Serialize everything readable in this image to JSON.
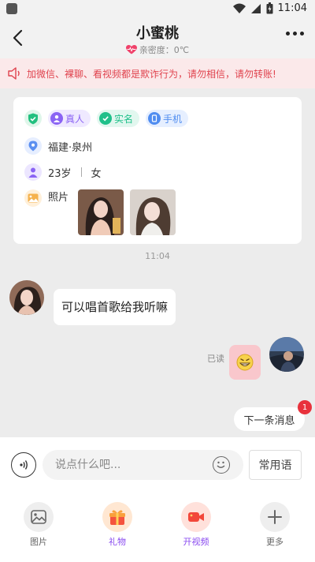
{
  "status_bar": {
    "time": "11:04"
  },
  "header": {
    "title": "小蜜桃",
    "intimacy": "亲密度：0℃"
  },
  "warning": {
    "text": "加微信、裸聊、看视频都是欺诈行为，请勿相信，请勿转账!"
  },
  "profile": {
    "tags": [
      {
        "label": "真人",
        "color": "#8a63f4",
        "bg": "#efe9ff"
      },
      {
        "label": "实名",
        "color": "#20c08a",
        "bg": "#e2f7ef"
      },
      {
        "label": "手机",
        "color": "#4f8cf0",
        "bg": "#e6efff"
      }
    ],
    "location": "福建·泉州",
    "age": "23岁",
    "gender": "女",
    "photos_label": "照片"
  },
  "chat": {
    "timestamp": "11:04",
    "incoming_message": "可以唱首歌给我听嘛",
    "read_status": "已读",
    "next_message_label": "下一条消息",
    "next_message_count": "1"
  },
  "input_bar": {
    "placeholder": "说点什么吧...",
    "phrases_label": "常用语"
  },
  "toolbar": [
    {
      "label": "图片",
      "icon": "image-icon",
      "color": "#666"
    },
    {
      "label": "礼物",
      "icon": "gift-icon",
      "color": "#8a4bf0"
    },
    {
      "label": "开视频",
      "icon": "video-icon",
      "color": "#8a4bf0"
    },
    {
      "label": "更多",
      "icon": "plus-icon",
      "color": "#666"
    }
  ],
  "colors": {
    "warning_red": "#e0434e",
    "bubble_out": "#f9c7cc",
    "badge_red": "#e8323c",
    "accent_purple": "#8a4bf0"
  }
}
